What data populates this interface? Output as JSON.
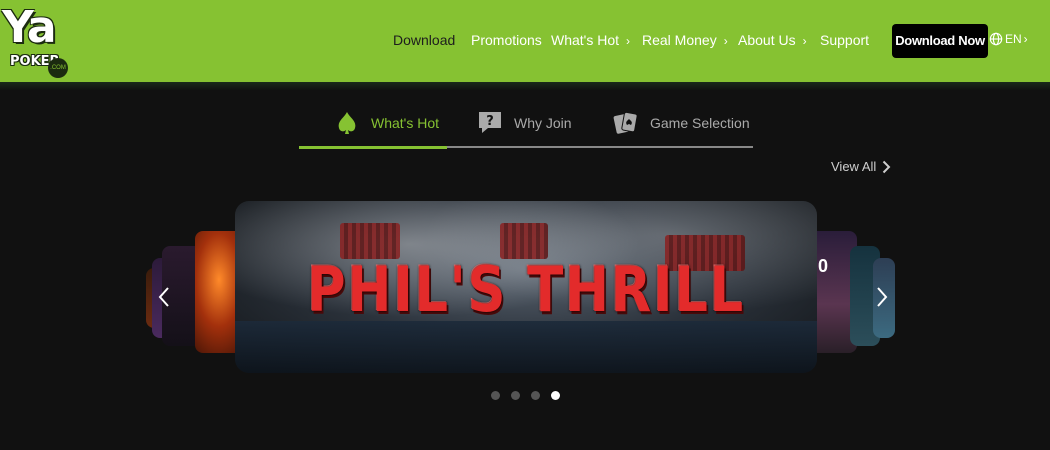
{
  "brand": {
    "logo_text": "Ya",
    "logo_sub": "POKER",
    "logo_badge": ".COM",
    "brand_color": "#86c232"
  },
  "nav": {
    "download": "Download",
    "promotions": "Promotions",
    "whats_hot": "What's Hot",
    "real_money": "Real Money",
    "about_us": "About Us",
    "support": "Support",
    "chevron": "›"
  },
  "cta": {
    "download_now": "Download Now"
  },
  "language": {
    "code": "EN",
    "icon": "globe-icon"
  },
  "tabs": [
    {
      "label": "What's Hot",
      "icon": "spade-flame-icon",
      "active": true
    },
    {
      "label": "Why Join",
      "icon": "question-bubble-icon",
      "active": false
    },
    {
      "label": "Game Selection",
      "icon": "cards-icon",
      "active": false
    }
  ],
  "view_all": "View All",
  "carousel": {
    "featured_title": "PHIL'S THRILL",
    "right_peek_text": "0",
    "slides_total": 4,
    "active_slide": 4
  }
}
